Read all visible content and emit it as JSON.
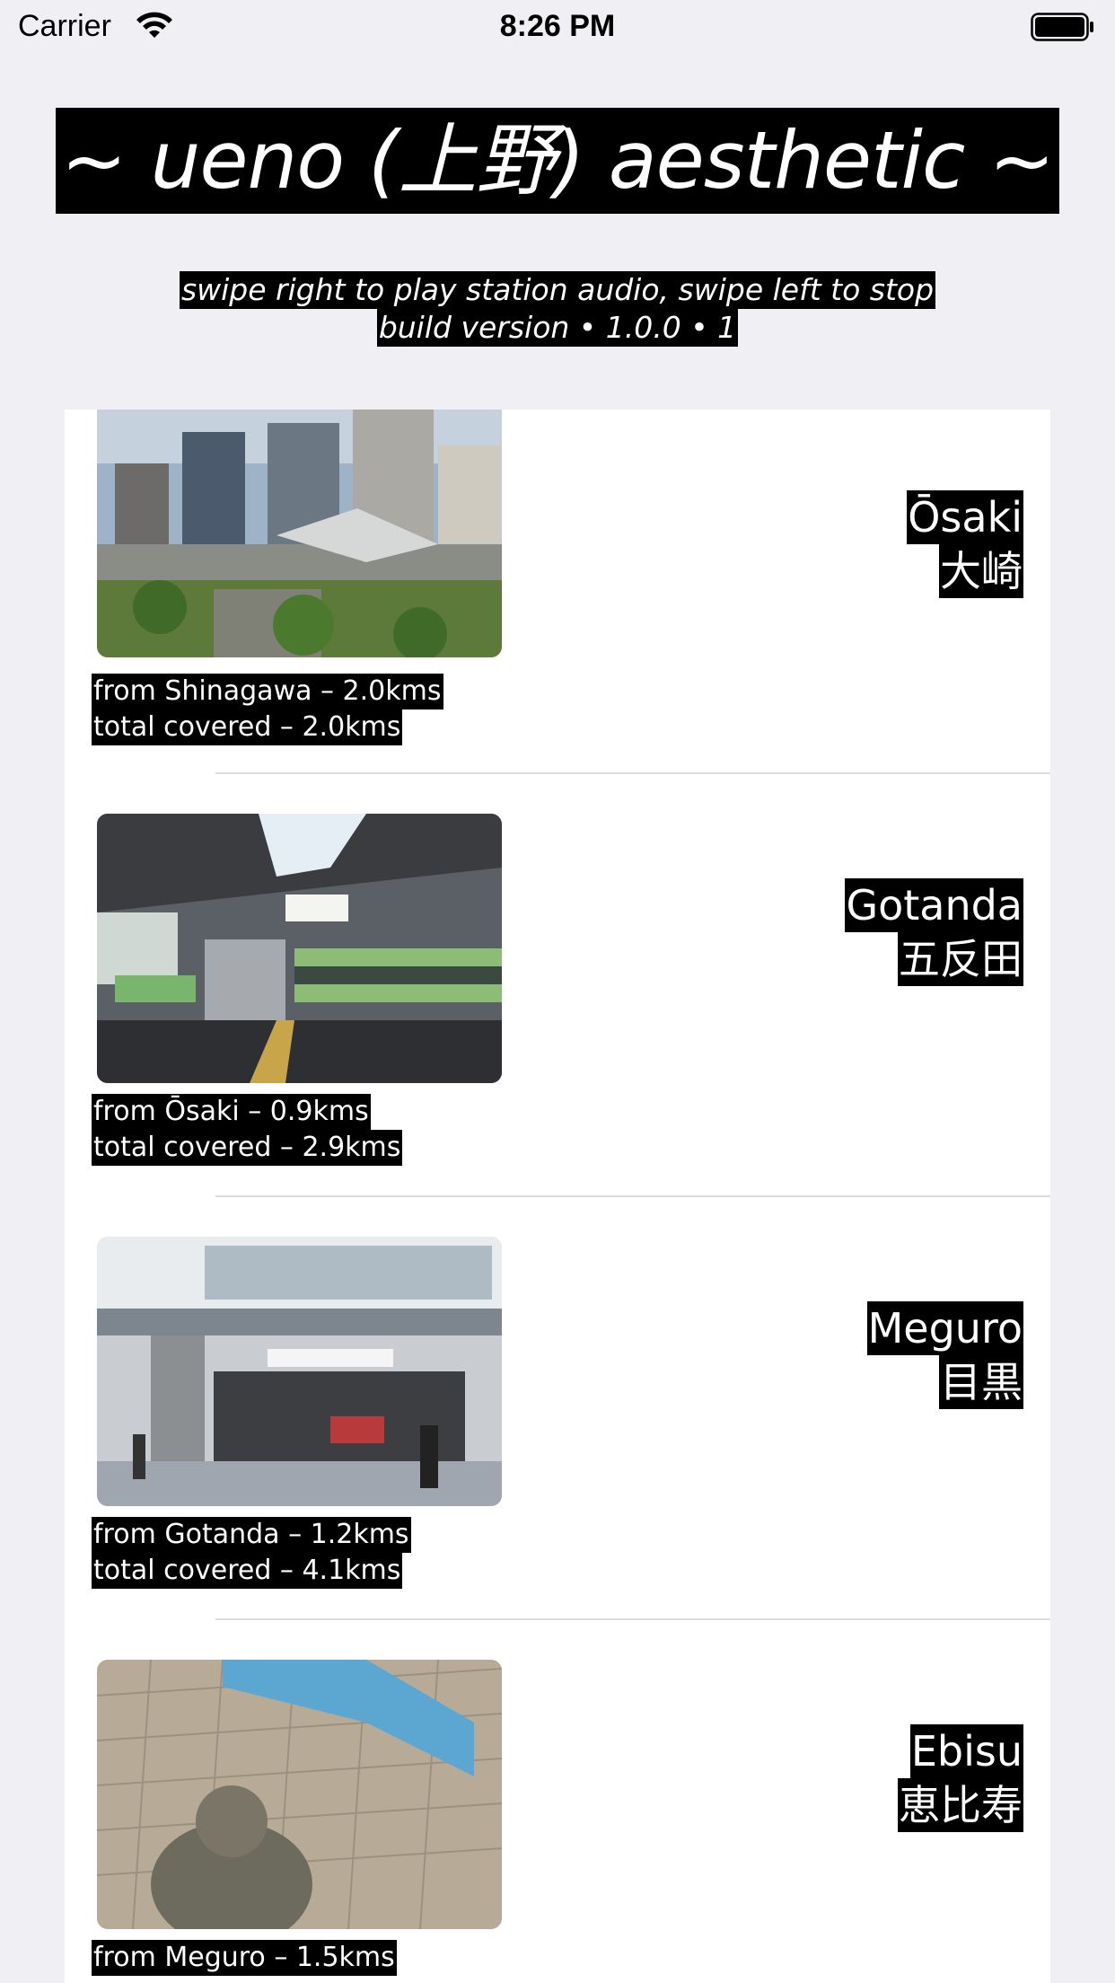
{
  "status_bar": {
    "carrier": "Carrier",
    "time": "8:26 PM",
    "wifi_icon": "wifi-icon",
    "battery_icon": "battery-full-icon"
  },
  "header": {
    "title": "~ ueno (上野) aesthetic ~",
    "subtitle_line1": "swipe right to play station audio, swipe left to stop",
    "subtitle_line2": "build version • 1.0.0 • 1"
  },
  "stations": [
    {
      "name_en": "Ōsaki",
      "name_jp": "大崎",
      "from": "from Shinagawa – 2.0kms",
      "total": "total covered – 2.0kms"
    },
    {
      "name_en": "Gotanda",
      "name_jp": "五反田",
      "from": "from Ōsaki – 0.9kms",
      "total": "total covered – 2.9kms"
    },
    {
      "name_en": "Meguro",
      "name_jp": "目黒",
      "from": "from Gotanda – 1.2kms",
      "total": "total covered – 4.1kms"
    },
    {
      "name_en": "Ebisu",
      "name_jp": "恵比寿",
      "from": "from Meguro – 1.5kms",
      "total": ""
    }
  ]
}
